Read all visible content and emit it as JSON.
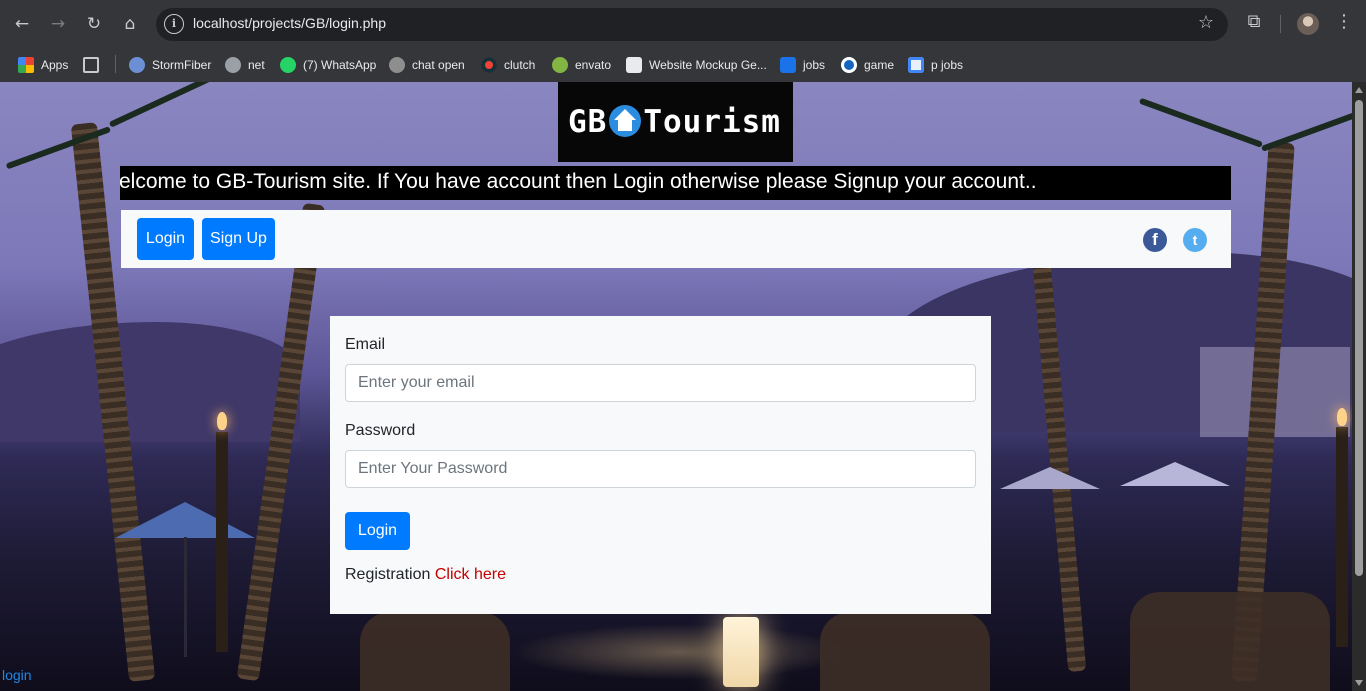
{
  "browser": {
    "url": "localhost/projects/GB/login.php",
    "bookmarks": [
      {
        "label": "Apps",
        "icon": "apps-grid-icon"
      },
      {
        "label": "",
        "icon": "tab-groups-icon"
      },
      {
        "label": "StormFiber",
        "icon": "stormfiber-icon"
      },
      {
        "label": "net",
        "icon": "globe-icon"
      },
      {
        "label": "(7) WhatsApp",
        "icon": "whatsapp-icon"
      },
      {
        "label": "chat open",
        "icon": "openai-icon"
      },
      {
        "label": "clutch",
        "icon": "clutch-icon"
      },
      {
        "label": "envato",
        "icon": "envato-icon"
      },
      {
        "label": "Website Mockup Ge...",
        "icon": "mockup-icon"
      },
      {
        "label": "jobs",
        "icon": "jobs-icon"
      },
      {
        "label": "game",
        "icon": "game-icon"
      },
      {
        "label": "p jobs",
        "icon": "pjobs-icon"
      }
    ]
  },
  "site": {
    "logo_left": "GB",
    "logo_right": "Tourism",
    "marquee": "elcome to GB-Tourism site. If You have account then Login otherwise please Signup your account..",
    "nav": {
      "login": "Login",
      "signup": "Sign Up"
    },
    "social": {
      "facebook": "f",
      "twitter": "t"
    }
  },
  "form": {
    "email_label": "Email",
    "email_placeholder": "Enter your email",
    "password_label": "Password",
    "password_placeholder": "Enter Your Password",
    "submit": "Login",
    "registration_text": "Registration",
    "registration_link": "Click here"
  },
  "footer_link": "login",
  "colors": {
    "primary": "#007bff",
    "link_red": "#c40000",
    "panel": "#f8f9fa"
  }
}
